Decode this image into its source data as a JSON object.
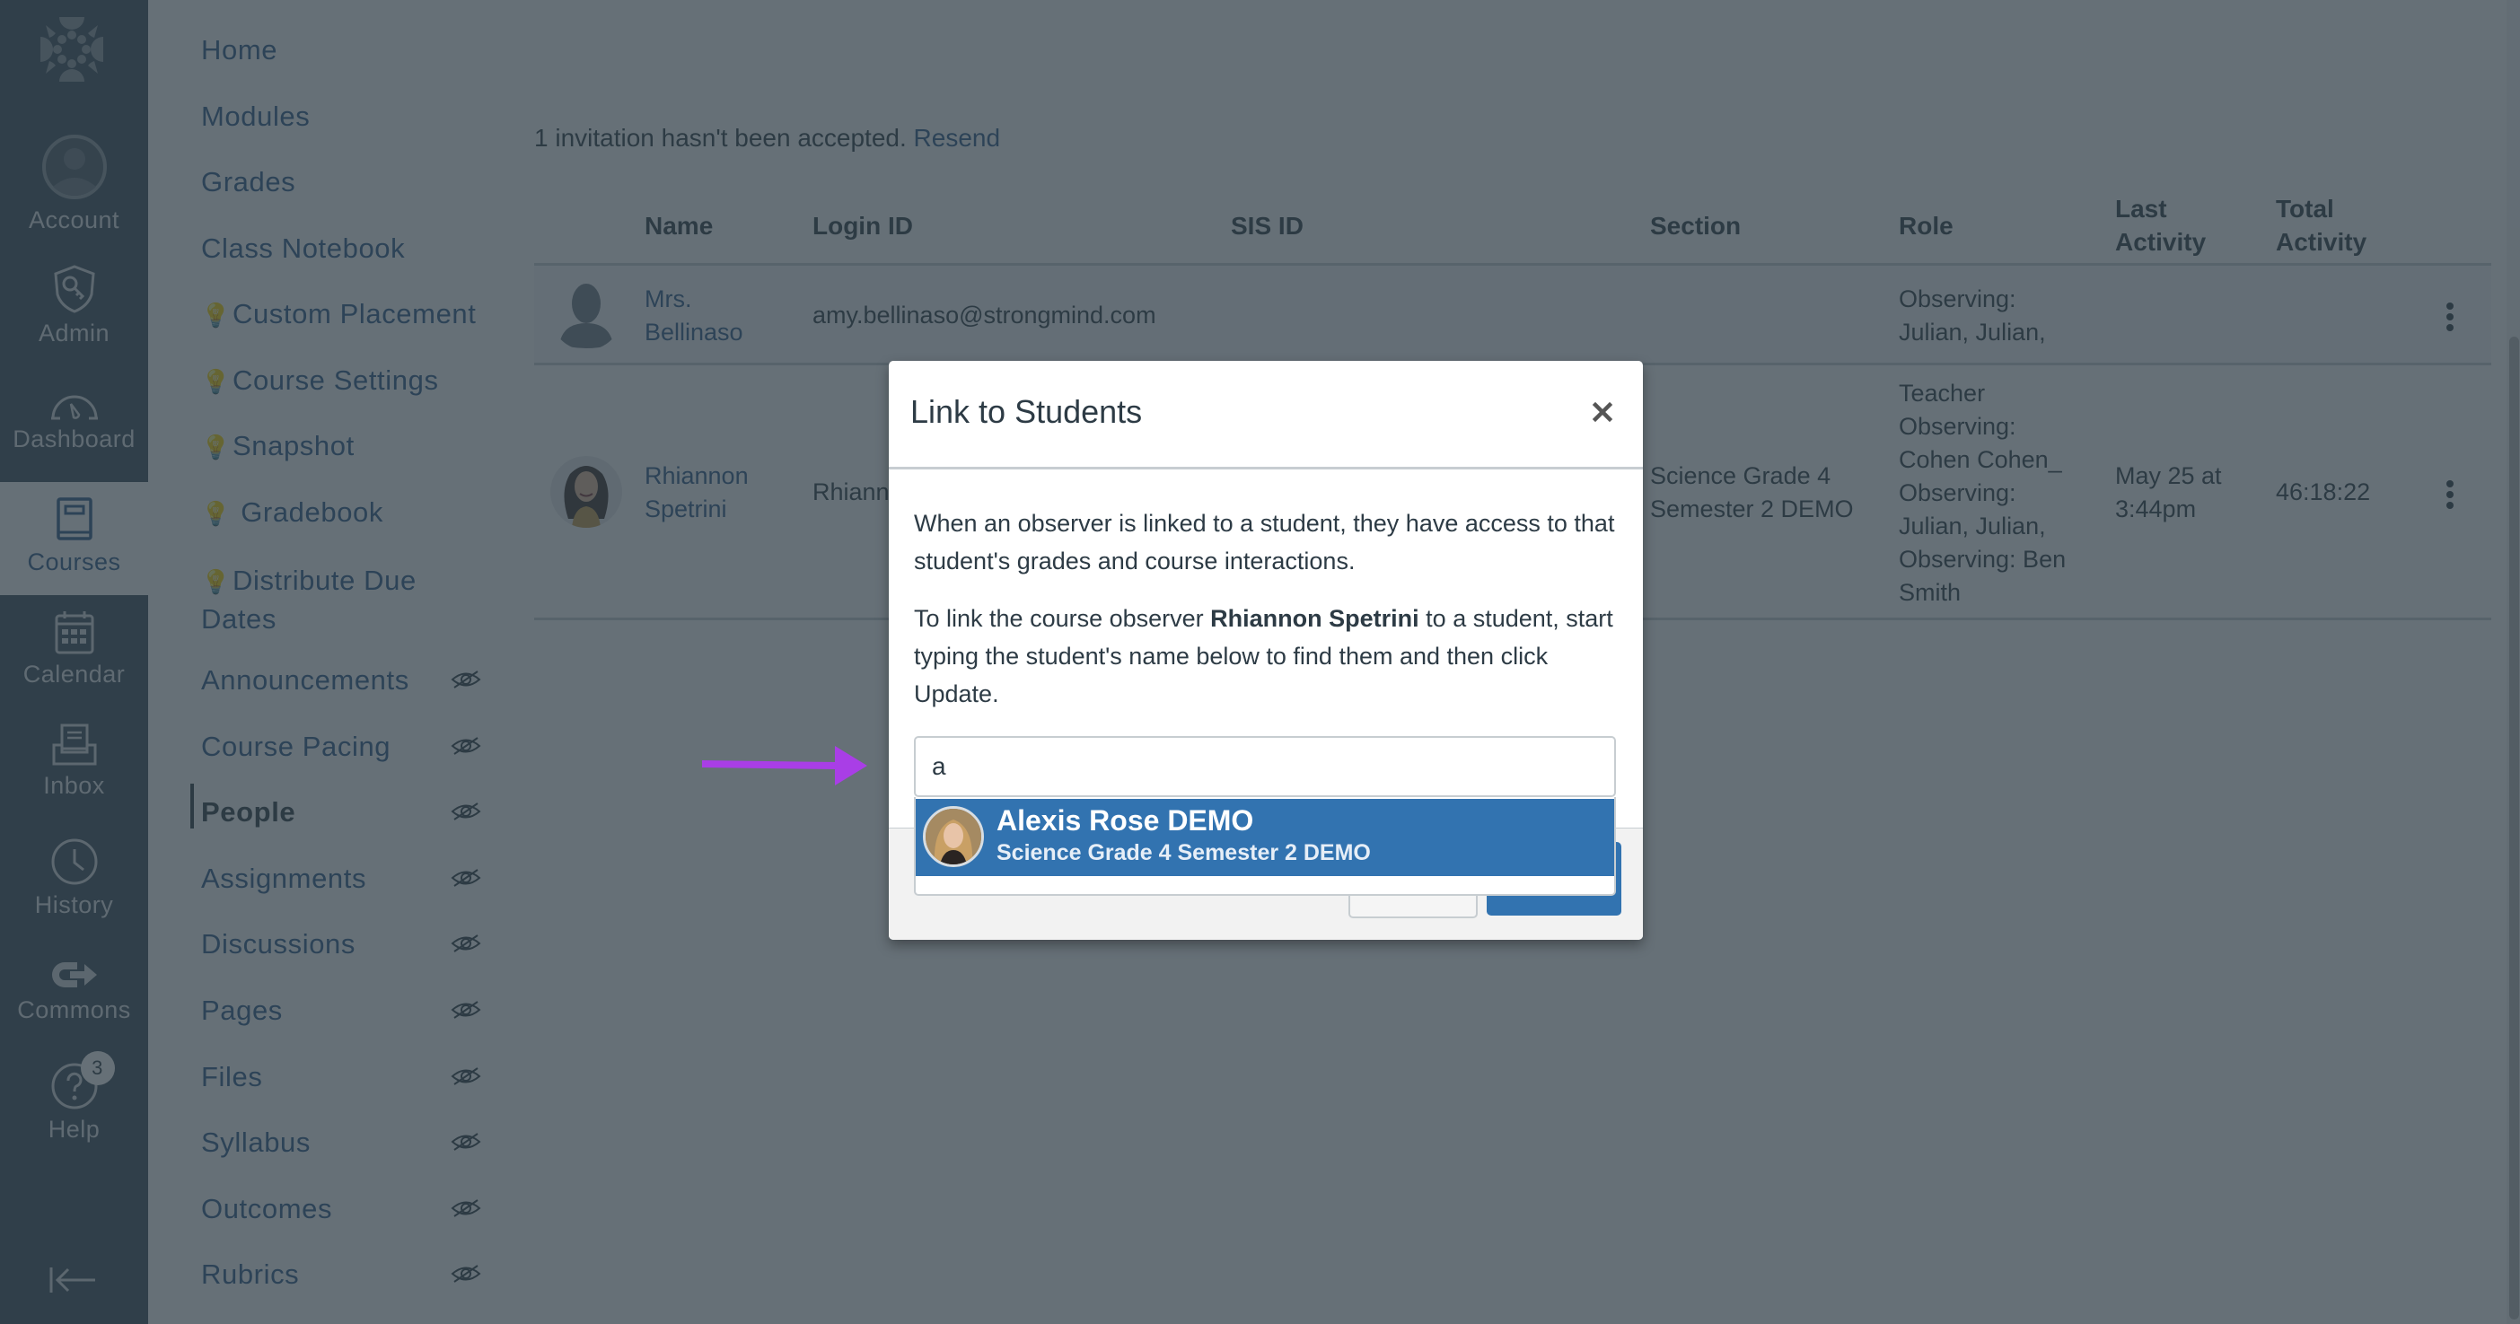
{
  "global_nav": {
    "items": [
      {
        "label": "Account",
        "icon": "account-avatar-icon"
      },
      {
        "label": "Admin",
        "icon": "admin-shield-key-icon"
      },
      {
        "label": "Dashboard",
        "icon": "dashboard-gauge-icon"
      },
      {
        "label": "Courses",
        "icon": "courses-book-icon",
        "active": true
      },
      {
        "label": "Calendar",
        "icon": "calendar-icon"
      },
      {
        "label": "Inbox",
        "icon": "inbox-icon"
      },
      {
        "label": "History",
        "icon": "history-clock-icon"
      },
      {
        "label": "Commons",
        "icon": "commons-icon"
      },
      {
        "label": "Help",
        "icon": "help-question-icon",
        "badge": "3"
      }
    ],
    "collapse_icon": "collapse-nav-icon",
    "logo_icon": "canvas-logo-icon"
  },
  "course_nav": {
    "items": [
      {
        "label": "Home"
      },
      {
        "label": "Modules"
      },
      {
        "label": "Grades"
      },
      {
        "label": "Class Notebook"
      },
      {
        "label": "Custom Placement",
        "bulb": true
      },
      {
        "label": "Course Settings",
        "bulb": true
      },
      {
        "label": "Snapshot",
        "bulb": true
      },
      {
        "label": " Gradebook",
        "bulb": true
      },
      {
        "label": "Distribute Due",
        "label2": "Dates",
        "bulb": true
      },
      {
        "label": "Announcements",
        "hidden": true
      },
      {
        "label": "Course Pacing",
        "hidden": true
      },
      {
        "label": "People",
        "hidden": true,
        "active": true
      },
      {
        "label": "Assignments",
        "hidden": true
      },
      {
        "label": "Discussions",
        "hidden": true
      },
      {
        "label": "Pages",
        "hidden": true
      },
      {
        "label": "Files",
        "hidden": true
      },
      {
        "label": "Syllabus",
        "hidden": true
      },
      {
        "label": "Outcomes",
        "hidden": true
      },
      {
        "label": "Rubrics",
        "hidden": true
      }
    ],
    "bulb_glyph": "💡"
  },
  "people": {
    "invitation_text": "1 invitation hasn't been accepted.",
    "resend_link": "Resend",
    "columns": {
      "name": "Name",
      "login_id": "Login ID",
      "sis_id": "SIS ID",
      "section": "Section",
      "role": "Role",
      "last_activity_1": "Last",
      "last_activity_2": "Activity",
      "total_activity_1": "Total",
      "total_activity_2": "Activity"
    },
    "rows": [
      {
        "name_1": "Mrs.",
        "name_2": "Bellinaso",
        "login_id": "amy.bellinaso@strongmind.com",
        "sis_id": "",
        "section": "",
        "role_lines": [
          "Observing:",
          "Julian, Julian,"
        ],
        "last_activity": "",
        "total_activity": ""
      },
      {
        "name_1": "Rhiannon",
        "name_2": "Spetrini",
        "login_id": "Rhiann",
        "sis_id": "",
        "section_1": "Science Grade 4",
        "section_2": "Semester 2 DEMO",
        "role_lines": [
          "Teacher",
          "Observing:",
          "Cohen Cohen_",
          "Observing:",
          "Julian, Julian,",
          "Observing: Ben",
          "Smith"
        ],
        "last_activity_1": "May 25 at",
        "last_activity_2": "3:44pm",
        "total_activity": "46:18:22"
      }
    ]
  },
  "modal": {
    "title": "Link to Students",
    "close_icon": "close-icon",
    "paragraph1": "When an observer is linked to a student, they have access to that student's grades and course interactions.",
    "paragraph2_before": "To link the course observer ",
    "paragraph2_bold": "Rhiannon Spetrini",
    "paragraph2_after": " to a student, start typing the student's name below to find them and then click Update.",
    "input_value": "a",
    "suggestion": {
      "name": "Alexis Rose DEMO",
      "section": "Science Grade 4 Semester 2 DEMO"
    }
  },
  "colors": {
    "global_nav_bg": "#394b58",
    "link": "#2d5a8a",
    "primary_button": "#3273b0",
    "annotation_arrow": "#a93ee6",
    "overlay": "rgba(45,59,69,0.73)"
  }
}
